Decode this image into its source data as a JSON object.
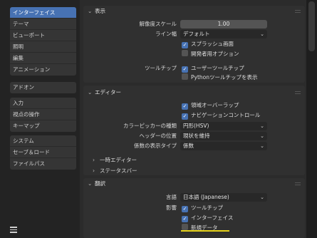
{
  "sidebar": {
    "groups": [
      [
        "インターフェイス",
        "テーマ",
        "ビューポート",
        "照明",
        "編集",
        "アニメーション"
      ],
      [
        "アドオン"
      ],
      [
        "入力",
        "視点の操作",
        "キーマップ"
      ],
      [
        "システム",
        "セーブ＆ロード",
        "ファイルパス"
      ]
    ]
  },
  "display": {
    "header": "表示",
    "resolution_label": "解像度スケール",
    "resolution_value": "1.00",
    "linewidth_label": "ライン幅",
    "linewidth_value": "デフォルト",
    "splash": "スプラッシュ画面",
    "devextras": "開発者用オプション",
    "tooltip_label": "ツールチップ",
    "user_tooltips": "ユーザーツールチップ",
    "python_tooltips": "Pythonツールチップを表示"
  },
  "editors": {
    "header": "エディター",
    "region_overlap": "領域オーバーラップ",
    "nav_controls": "ナビゲーションコントロール",
    "picker_label": "カラーピッカーの種類",
    "picker_value": "円形(HSV)",
    "header_pos_label": "ヘッダーの位置",
    "header_pos_value": "現状を維持",
    "factor_label": "係数の表示タイプ",
    "factor_value": "係数",
    "temp_editors": "一時エディター",
    "status_bar": "ステータスバー"
  },
  "translation": {
    "header": "翻訳",
    "language_label": "言語",
    "language_value": "日本語 (Japanese)",
    "affect_label": "影響",
    "tooltips": "ツールチップ",
    "interface": "インターフェイス",
    "new_data": "新規データ"
  },
  "colors": {
    "accent": "#4772b3",
    "highlight": "#e6d21a"
  }
}
